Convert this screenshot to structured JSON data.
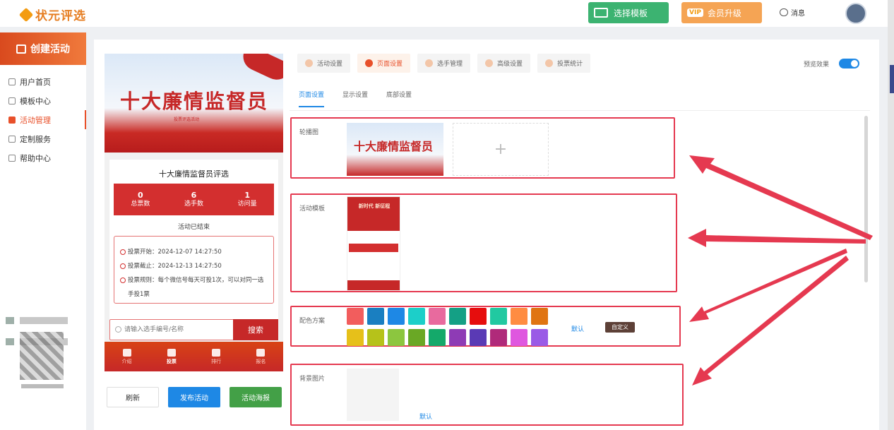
{
  "header": {
    "logo_text": "状元评选",
    "template_button": "选择模板",
    "vip_badge": "VIP",
    "vip_button": "会员升级",
    "messages": "消息"
  },
  "sidebar": {
    "create_button": "创建活动",
    "items": [
      {
        "label": "用户首页",
        "icon": "home-icon",
        "active": false
      },
      {
        "label": "模板中心",
        "icon": "template-icon",
        "active": false
      },
      {
        "label": "活动管理",
        "icon": "activity-icon",
        "active": true
      },
      {
        "label": "定制服务",
        "icon": "custom-icon",
        "active": false
      },
      {
        "label": "帮助中心",
        "icon": "help-icon",
        "active": false
      }
    ]
  },
  "preview": {
    "banner_title": "十大廉情监督员",
    "banner_subtitle": "投票评选活动",
    "activity_title": "十大廉情监督员评选",
    "stats": [
      {
        "value": "0",
        "label": "总票数"
      },
      {
        "value": "6",
        "label": "选手数"
      },
      {
        "value": "1",
        "label": "访问量"
      }
    ],
    "status": "活动已结束",
    "info": [
      "投票开始：2024-12-07 14:27:50",
      "投票截止：2024-12-13 14:27:50",
      "投票规则：每个微信号每天可投1次，可以对同一选手投1票"
    ],
    "search_placeholder": "请输入选手编号/名称",
    "search_button": "搜索",
    "bottom_nav": [
      {
        "label": "介绍",
        "active": false
      },
      {
        "label": "投票",
        "active": true
      },
      {
        "label": "排行",
        "active": false
      },
      {
        "label": "报名",
        "active": false
      }
    ]
  },
  "actions": {
    "refresh": "刷新",
    "publish": "发布活动",
    "poster": "活动海报"
  },
  "tabs": [
    "活动设置",
    "页面设置",
    "选手管理",
    "高级设置",
    "投票统计"
  ],
  "active_tab": "页面设置",
  "preview_toggle_label": "预览效果",
  "subtabs": [
    "页面设置",
    "显示设置",
    "底部设置"
  ],
  "sections": {
    "carousel_label": "轮播图",
    "carousel_thumb_title": "十大廉情监督员",
    "add_symbol": "+",
    "template_label": "活动模板",
    "template_thumb_title": "新时代 新征程",
    "color_label": "配色方案",
    "color_default": "默认",
    "color_custom": "自定义",
    "bg_label": "背景图片",
    "bg_default": "默认"
  },
  "colors": {
    "swatches": [
      "#f25d5d",
      "#1a7fc1",
      "#1e88e5",
      "#1ccfc9",
      "#e86a9e",
      "#14a085",
      "#e60d0d",
      "#21c9a1",
      "#ff8c42",
      "#e07412",
      "#e6c01a",
      "#b6c21a",
      "#8cc63f",
      "#6aa825",
      "#14a96a",
      "#8e3bb5",
      "#5a3ab5",
      "#b02a7a",
      "#df57df",
      "#9a5ae6"
    ],
    "accent": "#e8502a",
    "highlight_box": "#e53950"
  }
}
